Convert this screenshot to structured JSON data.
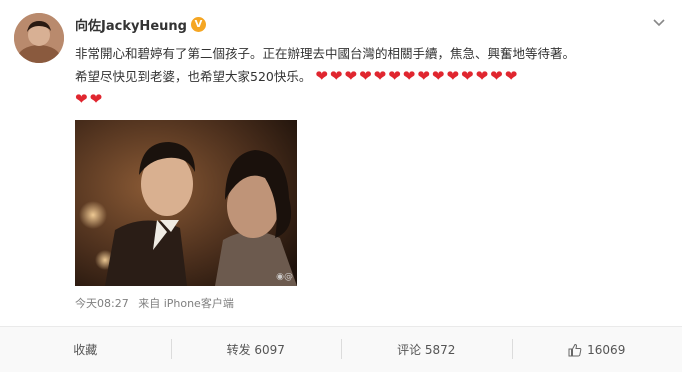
{
  "post": {
    "username": "向佐JackyHeung",
    "verified_icon": "verified-badge-icon",
    "text_line1": "非常開心和碧婷有了第二個孩子。正在辦理去中國台灣的相關手續，焦急、興奮地等待著。",
    "text_line2": "希望尽快见到老婆，也希望大家520快乐。",
    "hearts_line1": "❤❤❤❤❤❤❤❤❤❤❤❤❤❤",
    "hearts_line2": "❤❤",
    "timestamp": "今天08:27",
    "source": "来自 iPhone客户端",
    "photo_watermark": "◉@"
  },
  "actions": {
    "favorite_label": "收藏",
    "repost_label": "转发 6097",
    "comment_label": "评论 5872",
    "like_label": "16069"
  },
  "colors": {
    "heart": "#e0262f",
    "verified": "#f5a623",
    "meta_text": "#808080"
  }
}
